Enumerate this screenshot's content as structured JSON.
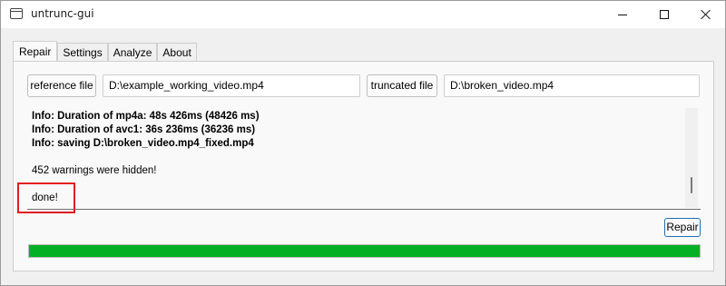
{
  "window": {
    "title": "untrunc-gui",
    "controls": {
      "minimize": "minimize",
      "maximize": "maximize",
      "close": "close"
    }
  },
  "tabs": [
    {
      "label": "Repair",
      "active": true
    },
    {
      "label": "Settings",
      "active": false
    },
    {
      "label": "Analyze",
      "active": false
    },
    {
      "label": "About",
      "active": false
    }
  ],
  "repair": {
    "reference_button": "reference file",
    "reference_path": "D:\\example_working_video.mp4",
    "truncated_button": "truncated file",
    "truncated_path": "D:\\broken_video.mp4",
    "log": [
      {
        "text": "Info: Duration of mp4a: 48s 426ms  (48426 ms)",
        "bold": true
      },
      {
        "text": "Info: Duration of avc1: 36s 236ms  (36236 ms)",
        "bold": true
      },
      {
        "text": "Info: saving D:\\broken_video.mp4_fixed.mp4",
        "bold": true
      },
      {
        "text": "",
        "bold": false
      },
      {
        "text": "452 warnings were hidden!",
        "bold": false
      },
      {
        "text": "",
        "bold": false
      },
      {
        "text": "done!",
        "bold": false
      }
    ],
    "repair_button": "Repair",
    "progress_percent": 100
  },
  "colors": {
    "progress": "#06b025",
    "highlight": "#e01f1f"
  }
}
